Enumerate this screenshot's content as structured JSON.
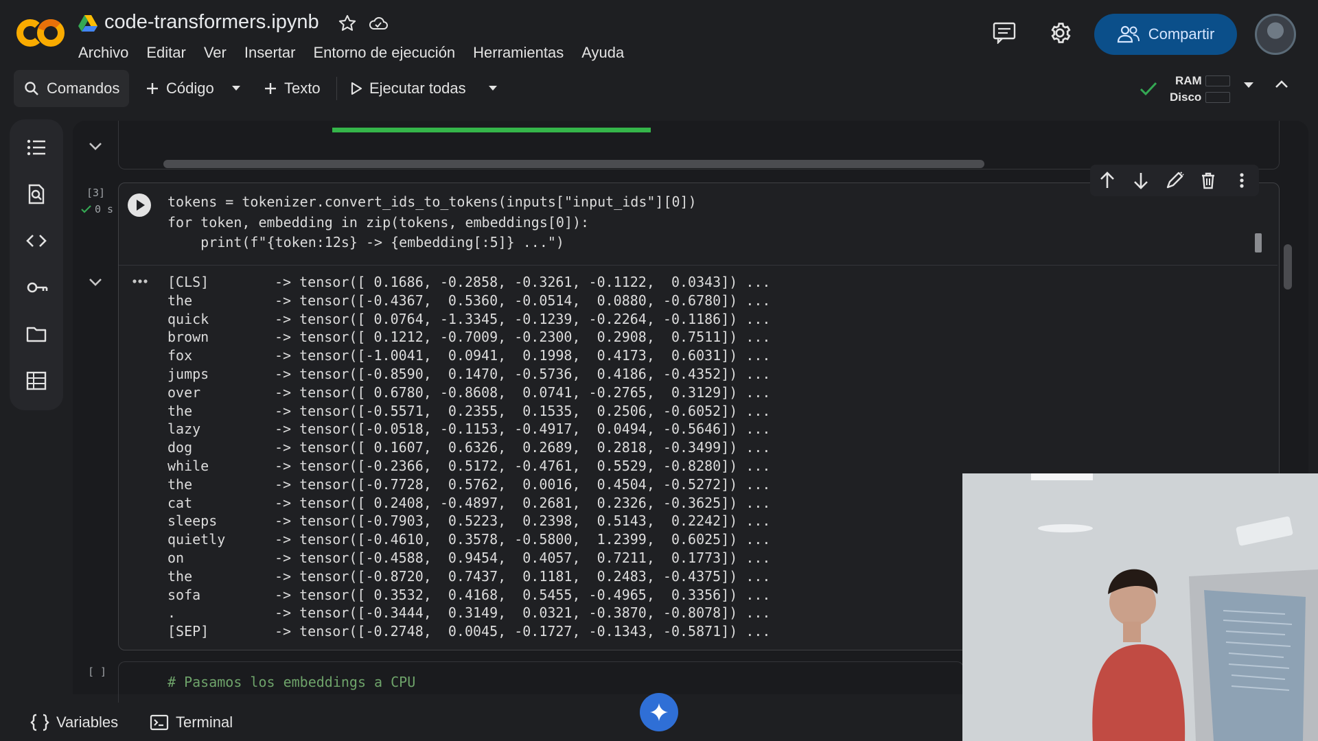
{
  "app": {
    "logo": "colab-logo",
    "title": "code-transformers.ipynb",
    "icons": [
      "google-drive-icon",
      "star-icon",
      "cloud-icon"
    ]
  },
  "menu": [
    "Archivo",
    "Editar",
    "Ver",
    "Insertar",
    "Entorno de ejecución",
    "Herramientas",
    "Ayuda"
  ],
  "header_actions": {
    "comments_icon": "comments-icon",
    "settings_icon": "gear-icon",
    "share_label": "Compartir"
  },
  "toolbar": {
    "commands": "Comandos",
    "add_code": "Código",
    "add_text": "Texto",
    "run_all": "Ejecutar todas",
    "ram_label": "RAM",
    "disk_label": "Disco"
  },
  "sidebar": [
    "toc-icon",
    "find-icon",
    "code-snippets-icon",
    "secrets-key-icon",
    "files-folder-icon",
    "variables-table-icon"
  ],
  "cell": {
    "exec_count": "[3]",
    "exec_time": "0 s",
    "code": [
      "tokens = tokenizer.convert_ids_to_tokens(inputs[\"input_ids\"][0])",
      "for token, embedding in zip(tokens, embeddings[0]):",
      "    print(f\"{token:12s} -> {embedding[:5]} ...\")"
    ],
    "output": [
      {
        "token": "[CLS]",
        "values": "-> tensor([ 0.1686, -0.2858, -0.3261, -0.1122,  0.0343]) ..."
      },
      {
        "token": "the",
        "values": "-> tensor([-0.4367,  0.5360, -0.0514,  0.0880, -0.6780]) ..."
      },
      {
        "token": "quick",
        "values": "-> tensor([ 0.0764, -1.3345, -0.1239, -0.2264, -0.1186]) ..."
      },
      {
        "token": "brown",
        "values": "-> tensor([ 0.1212, -0.7009, -0.2300,  0.2908,  0.7511]) ..."
      },
      {
        "token": "fox",
        "values": "-> tensor([-1.0041,  0.0941,  0.1998,  0.4173,  0.6031]) ..."
      },
      {
        "token": "jumps",
        "values": "-> tensor([-0.8590,  0.1470, -0.5736,  0.4186, -0.4352]) ..."
      },
      {
        "token": "over",
        "values": "-> tensor([ 0.6780, -0.8608,  0.0741, -0.2765,  0.3129]) ..."
      },
      {
        "token": "the",
        "values": "-> tensor([-0.5571,  0.2355,  0.1535,  0.2506, -0.6052]) ..."
      },
      {
        "token": "lazy",
        "values": "-> tensor([-0.0518, -0.1153, -0.4917,  0.0494, -0.5646]) ..."
      },
      {
        "token": "dog",
        "values": "-> tensor([ 0.1607,  0.6326,  0.2689,  0.2818, -0.3499]) ..."
      },
      {
        "token": "while",
        "values": "-> tensor([-0.2366,  0.5172, -0.4761,  0.5529, -0.8280]) ..."
      },
      {
        "token": "the",
        "values": "-> tensor([-0.7728,  0.5762,  0.0016,  0.4504, -0.5272]) ..."
      },
      {
        "token": "cat",
        "values": "-> tensor([ 0.2408, -0.4897,  0.2681,  0.2326, -0.3625]) ..."
      },
      {
        "token": "sleeps",
        "values": "-> tensor([-0.7903,  0.5223,  0.2398,  0.5143,  0.2242]) ..."
      },
      {
        "token": "quietly",
        "values": "-> tensor([-0.4610,  0.3578, -0.5800,  1.2399,  0.6025]) ..."
      },
      {
        "token": "on",
        "values": "-> tensor([-0.4588,  0.9454,  0.4057,  0.7211,  0.1773]) ..."
      },
      {
        "token": "the",
        "values": "-> tensor([-0.8720,  0.7437,  0.1181,  0.2483, -0.4375]) ..."
      },
      {
        "token": "sofa",
        "values": "-> tensor([ 0.3532,  0.4168,  0.5455, -0.4965,  0.3356]) ..."
      },
      {
        "token": ".",
        "values": "-> tensor([-0.3444,  0.3149,  0.0321, -0.3870, -0.8078]) ..."
      },
      {
        "token": "[SEP]",
        "values": "-> tensor([-0.2748,  0.0045, -0.1727, -0.1343, -0.5871]) ..."
      }
    ]
  },
  "next_cell": {
    "exec_count": "[ ]",
    "code": "# Pasamos los embeddings a CPU"
  },
  "statusbar": {
    "variables": "Variables",
    "terminal": "Terminal",
    "gemini_icon": "gemini-sparkle-icon"
  },
  "colors": {
    "accent_share": "#0b4f8a",
    "progress": "#35b54a",
    "background": "#1e1f22"
  }
}
